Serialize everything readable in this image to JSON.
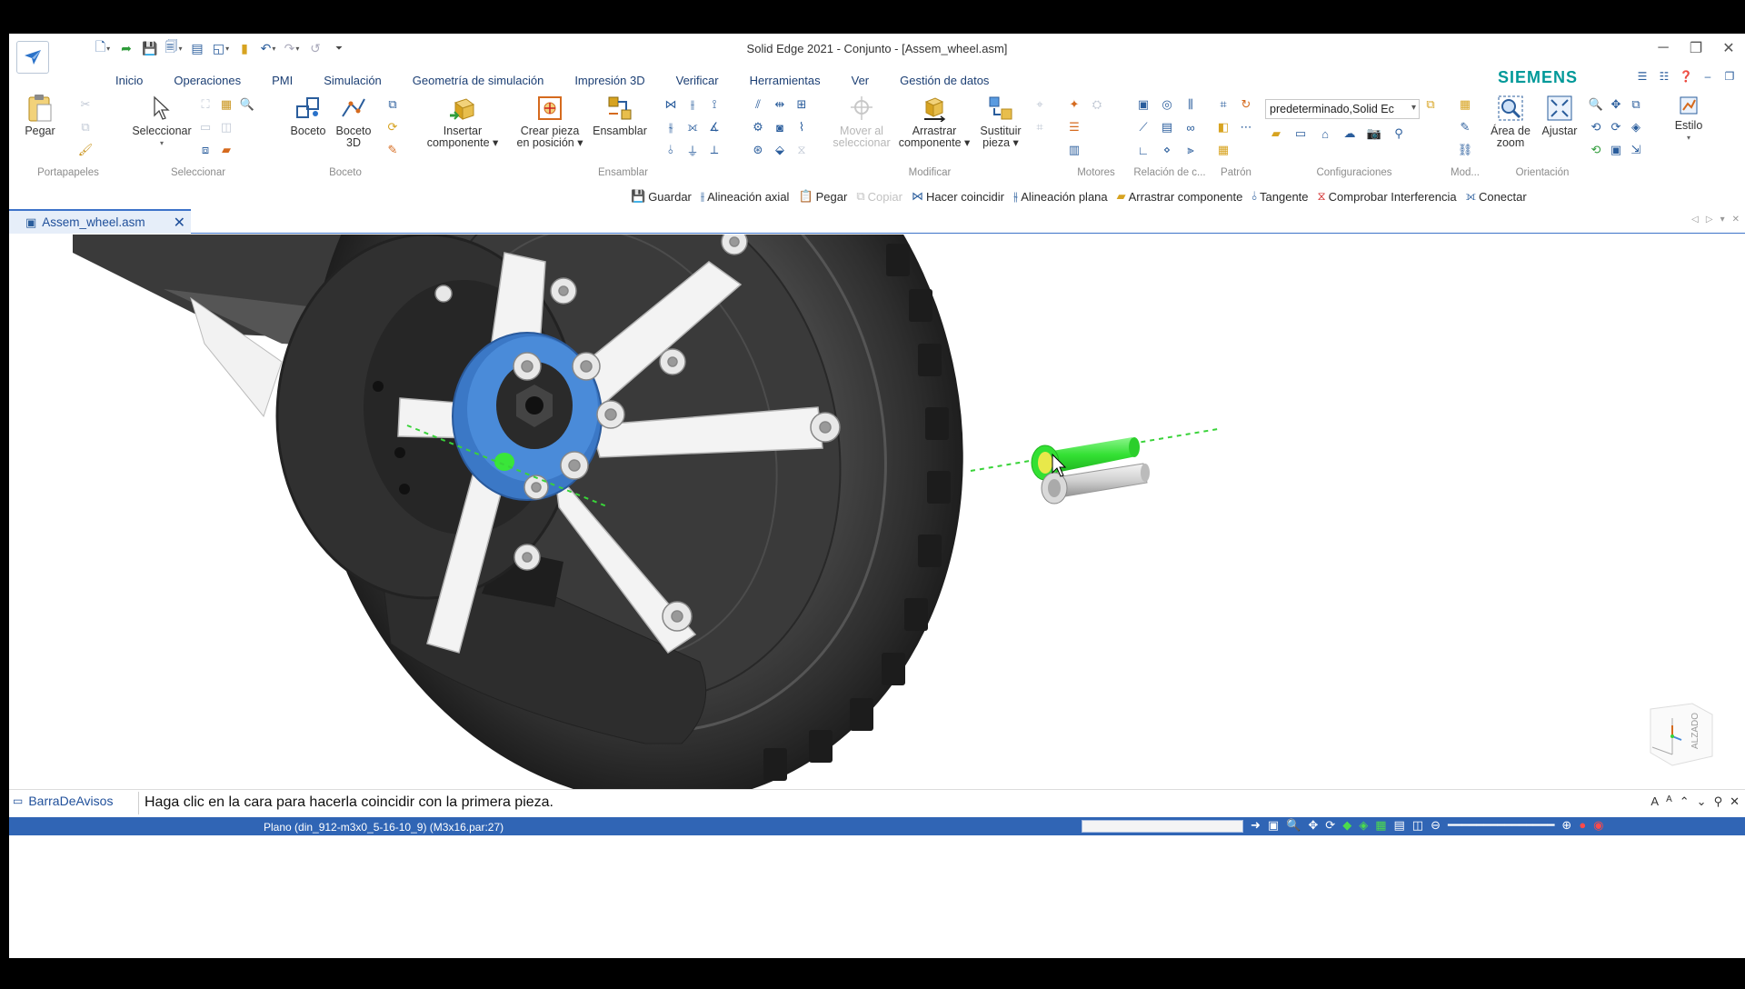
{
  "window": {
    "title": "Solid Edge 2021 - Conjunto - [Assem_wheel.asm]",
    "minimize": "─",
    "restore": "❐",
    "close": "✕"
  },
  "ribbon_tabs": [
    "Inicio",
    "Operaciones",
    "PMI",
    "Simulación",
    "Geometría de simulación",
    "Impresión 3D",
    "Verificar",
    "Herramientas",
    "Ver",
    "Gestión de datos"
  ],
  "brand": "SIEMENS",
  "ribbon": {
    "portapapeles": {
      "label": "Portapapeles",
      "pegar": "Pegar"
    },
    "seleccionar": {
      "label": "Seleccionar",
      "seleccionar": "Seleccionar"
    },
    "boceto": {
      "label": "Boceto",
      "boceto": "Boceto",
      "boceto3d_1": "Boceto",
      "boceto3d_2": "3D"
    },
    "insertar_1": "Insertar",
    "insertar_2": "componente",
    "crear_1": "Crear pieza",
    "crear_2": "en posición",
    "ensamblar": {
      "label": "Ensamblar",
      "ensamblar": "Ensamblar"
    },
    "modificar": {
      "label": "Modificar",
      "mover_1": "Mover al",
      "mover_2": "seleccionar",
      "arrastrar_1": "Arrastrar",
      "arrastrar_2": "componente",
      "sustituir_1": "Sustituir",
      "sustituir_2": "pieza"
    },
    "motores": {
      "label": "Motores"
    },
    "relacion": {
      "label": "Relación de c..."
    },
    "patron": {
      "label": "Patrón"
    },
    "configuraciones": {
      "label": "Configuraciones",
      "select_value": "predeterminado,Solid Ec"
    },
    "modelo": {
      "label": "Mod..."
    },
    "orientacion": {
      "label": "Orientación",
      "area_1": "Área de",
      "area_2": "zoom",
      "ajustar": "Ajustar"
    },
    "estilo": {
      "label": "Estilo"
    }
  },
  "command_bar": [
    {
      "label": "Guardar",
      "icon": "save-icon",
      "enabled": true
    },
    {
      "label": "Alineación axial",
      "icon": "axial-align-icon",
      "enabled": true
    },
    {
      "label": "Pegar",
      "icon": "paste-icon",
      "enabled": true
    },
    {
      "label": "Copiar",
      "icon": "copy-icon",
      "enabled": false
    },
    {
      "label": "Hacer coincidir",
      "icon": "mate-icon",
      "enabled": true
    },
    {
      "label": "Alineación plana",
      "icon": "planar-align-icon",
      "enabled": true
    },
    {
      "label": "Arrastrar componente",
      "icon": "drag-component-icon",
      "enabled": true
    },
    {
      "label": "Tangente",
      "icon": "tangent-icon",
      "enabled": true
    },
    {
      "label": "Comprobar Interferencia",
      "icon": "interference-icon",
      "enabled": true
    },
    {
      "label": "Conectar",
      "icon": "connect-icon",
      "enabled": true
    }
  ],
  "document_tab": {
    "label": "Assem_wheel.asm"
  },
  "viewcube": {
    "label": "ALZADO"
  },
  "prompt": {
    "notify_label": "BarraDeAvisos",
    "message": "Haga clic en la cara para hacerla coincidir con la primera pieza."
  },
  "status": {
    "text": "Plano (din_912-m3x0_5-16-10_9) (M3x16.par:27)"
  },
  "colors": {
    "accent": "#3d73c9",
    "brand": "#009999",
    "status_bar": "#3065b5",
    "highlight_green": "#39e639",
    "hub_blue": "#3b78c6"
  }
}
